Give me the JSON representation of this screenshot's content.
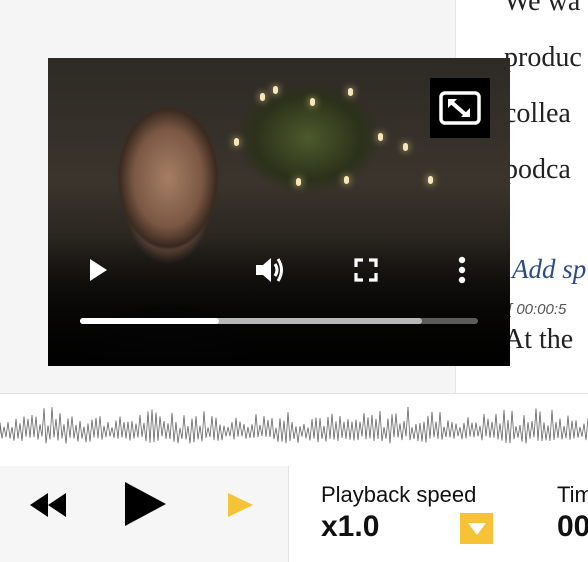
{
  "transcript": {
    "lines": [
      "We wa",
      "produc",
      "collea",
      "podca"
    ],
    "speaker_placeholder": "Add sp",
    "timestamp": "[ 00:00:5",
    "next_line": "At the",
    "cut_line": "……"
  },
  "video_player": {
    "progress_fraction": 0.35,
    "buffered_fraction": 0.86,
    "icons": [
      "exit-picture-in-picture-icon",
      "play-icon",
      "volume-icon",
      "fullscreen-icon",
      "more-options-icon"
    ]
  },
  "controls": {
    "speed_label": "Playback speed",
    "speed_value": "x1.0",
    "time_label": "Tim",
    "time_value": "00",
    "icons": [
      "rewind-icon",
      "play-icon",
      "next-icon",
      "dropdown-arrow-icon"
    ]
  },
  "colors": {
    "accent": "#f6c336",
    "link": "#2b4a86",
    "waveform": "#666666"
  }
}
